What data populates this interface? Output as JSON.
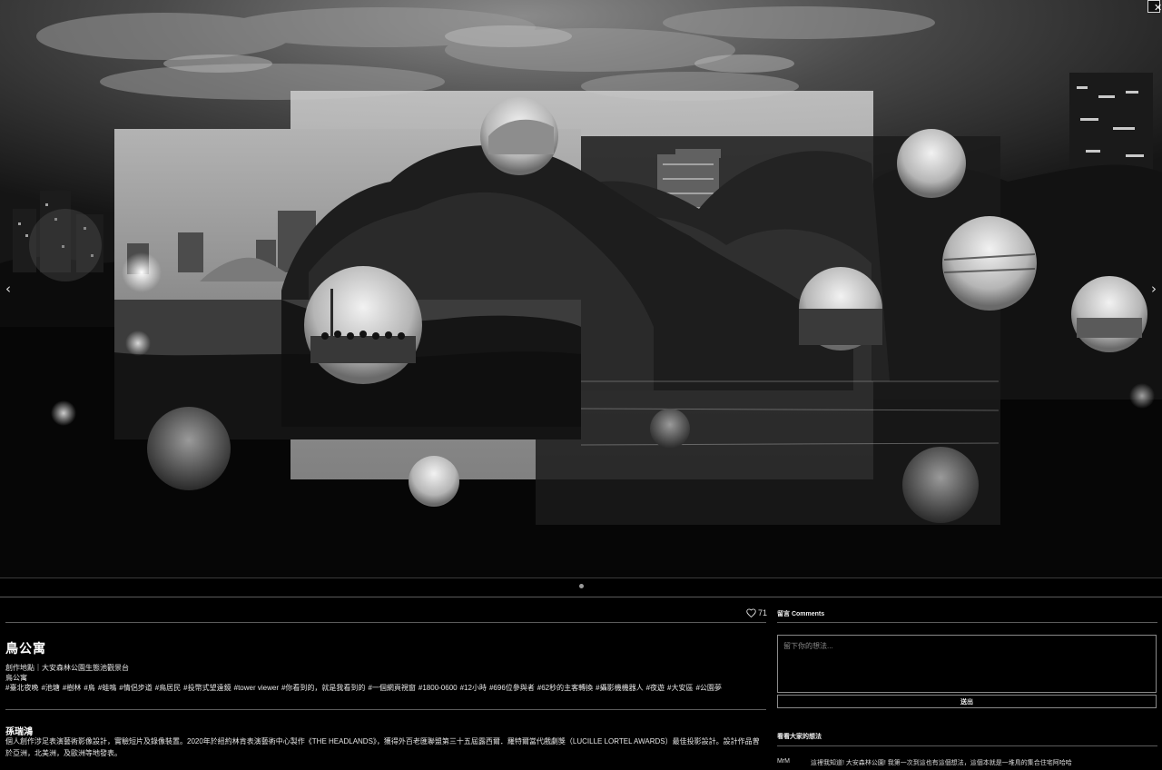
{
  "controls": {
    "close": "✕",
    "prev": "‹",
    "next": "›"
  },
  "likes": {
    "icon": "heart-outline-icon",
    "count": "71"
  },
  "work": {
    "title": "鳥公寓",
    "location": "創作地點｜大安森林公園生態池觀景台",
    "alt_title": "鳥公寓",
    "tags": [
      "#臺北夜晚",
      "#池塘",
      "#樹林",
      "#鳥",
      "#蛙鳴",
      "#情侶步道",
      "#鳥居民",
      "#投幣式望遠鏡",
      "#tower viewer",
      "#你看到的，就是我看到的",
      "#一個網頁視窗",
      "#1800-0600",
      "#12小時",
      "#696位參與者",
      "#62秒的主客轉換",
      "#攝影機機器人",
      "#夜遊",
      "#大安區",
      "#公園夢"
    ]
  },
  "artist": {
    "name": "孫瑞鴻",
    "bio": "個人創作涉足表演藝術影像設計，實驗短片及錄像裝置。2020年於紐約林肯表演藝術中心製作《THE HEADLANDS》，獲得外百老匯聯盟第三十五屆露西爾．羅特爾當代戲劇獎（LUCILLE LORTEL AWARDS）最佳投影設計。設計作品曾於亞洲，北美洲，及歐洲等地發表。"
  },
  "comments": {
    "heading": "留言  Comments",
    "placeholder": "留下你的想法...",
    "submit": "送出",
    "list_heading": "看看大家的想法",
    "items": [
      {
        "user": "MrM",
        "text": "這裡我知道! 大安森林公園! 我第一次到這也有這個想法，這個本就是一堆鳥的集合住宅阿哈哈"
      }
    ]
  }
}
